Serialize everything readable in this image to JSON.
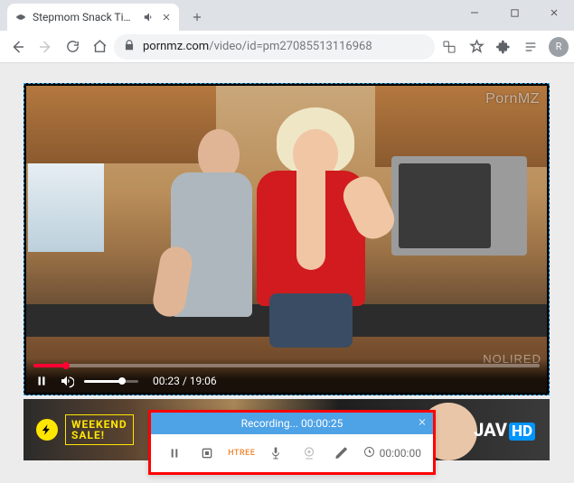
{
  "browser": {
    "tab_title": "Stepmom Snack Time porn - …",
    "url_host": "pornmz.com",
    "url_path": "/video/id=pm27085513116968",
    "avatar_initial": "R"
  },
  "video": {
    "watermark_top_right": "PornMZ",
    "watermark_bottom_right": "NOLIRED",
    "current_time": "00:23",
    "duration": "19:06",
    "time_label": "00:23 / 19:06"
  },
  "banner": {
    "promo_line1": "WEEKEND",
    "promo_line2": "SALE!",
    "brand_prefix": "JAV",
    "brand_suffix": "HD"
  },
  "recorder": {
    "status_prefix": "Recording... ",
    "status_time": "00:00:25",
    "elapsed_label": "00:00:00",
    "tool_text": "HTREE"
  }
}
